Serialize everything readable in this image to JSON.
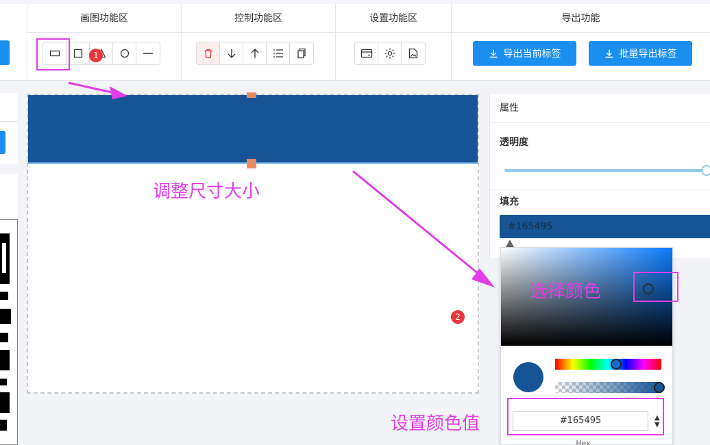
{
  "toolbar": {
    "groups": {
      "draw": {
        "title": "画图功能区"
      },
      "control": {
        "title": "控制功能区"
      },
      "settings": {
        "title": "设置功能区"
      },
      "export": {
        "title": "导出功能"
      }
    },
    "draw_tools": [
      "rectangle-outline-icon",
      "square-icon",
      "triangle-icon",
      "circle-icon",
      "line-icon"
    ],
    "control_tools": [
      "trash-icon",
      "arrow-down-icon",
      "arrow-up-icon",
      "list-icon",
      "copy-icon"
    ],
    "settings_tools": [
      "card-icon",
      "gear-icon",
      "image-file-icon"
    ],
    "export_current_label": "导出当前标签",
    "export_batch_label": "批量导出标签"
  },
  "panel": {
    "header": "属性",
    "opacity_label": "透明度",
    "opacity_value": 1.0,
    "fill_label": "填充",
    "fill_value": "#165495"
  },
  "picker": {
    "hex_value": "#165495",
    "hex_label": "Hex"
  },
  "colors": {
    "fill": "#165495",
    "accent": "#1a8ff0",
    "annotation": "#e23ee8",
    "handle": "#e58a63"
  },
  "annotations": {
    "badge_1": "1",
    "badge_2": "2",
    "resize_text": "调整尺寸大小",
    "choose_color_text": "选择颜色",
    "set_color_text": "设置颜色值"
  }
}
